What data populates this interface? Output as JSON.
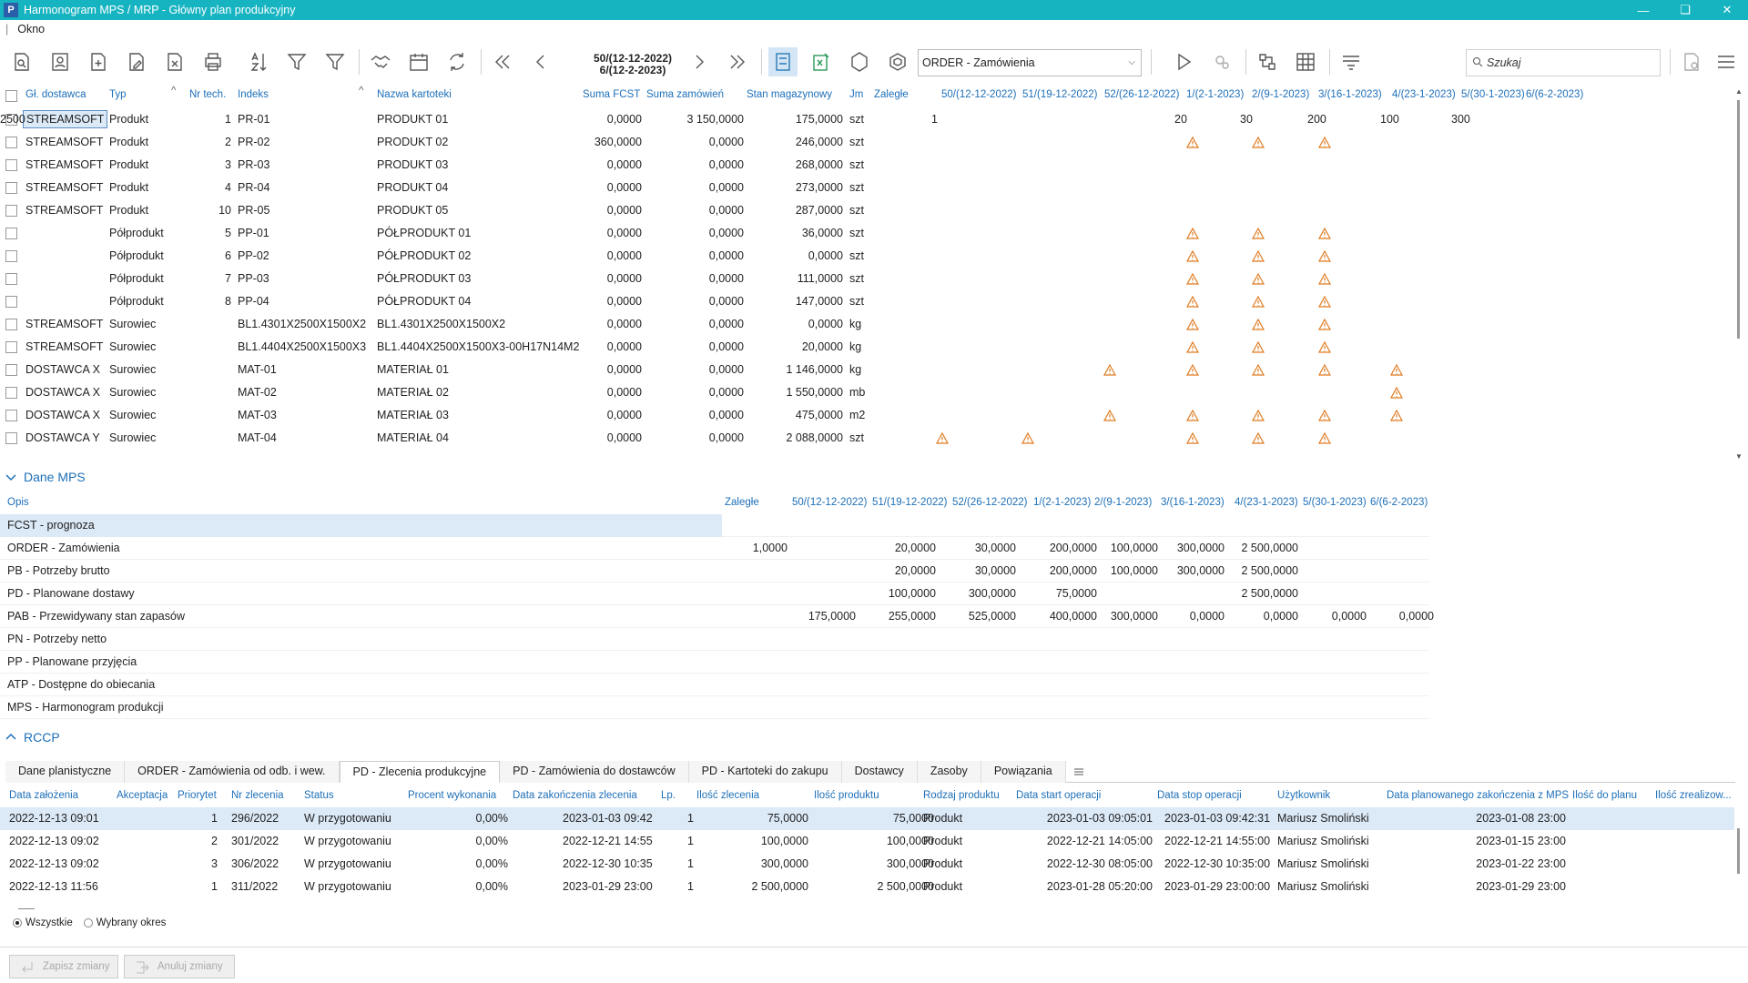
{
  "window": {
    "title": "Harmonogram MPS / MRP  - Główny plan produkcyjny",
    "app_icon": "P"
  },
  "menu": {
    "items": [
      "Okno"
    ]
  },
  "toolbar": {
    "period_line1": "50/(12-12-2022)",
    "period_line2": "6/(12-2-2023)",
    "order_select": "ORDER - Zamówienia",
    "search_placeholder": "Szukaj"
  },
  "grid": {
    "headers": {
      "dostawca": "Gł. dostawca",
      "typ": "Typ",
      "nrtech": "Nr tech.",
      "indeks": "Indeks",
      "nazwa": "Nazwa kartoteki",
      "fcst": "Suma FCST",
      "zam": "Suma zamówień",
      "stan": "Stan magazynowy",
      "jm": "Jm",
      "zalegle": "Zaległe",
      "periods": [
        "50/(12-12-2022)",
        "51/(19-12-2022)",
        "52/(26-12-2022)",
        "1/(2-1-2023)",
        "2/(9-1-2023)",
        "3/(16-1-2023)",
        "4/(23-1-2023)",
        "5/(30-1-2023)",
        "6/(6-2-2023)"
      ]
    },
    "rows": [
      {
        "dost": "STREAMSOFT",
        "typ": "Produkt",
        "nr": "1",
        "idx": "PR-01",
        "nazwa": "PRODUKT 01",
        "fcst": "0,0000",
        "zam": "3 150,0000",
        "stan": "175,0000",
        "jm": "szt",
        "vals": [
          "1",
          "",
          "20",
          "30",
          "200",
          "100",
          "300",
          "2500"
        ],
        "warn": []
      },
      {
        "dost": "STREAMSOFT",
        "typ": "Produkt",
        "nr": "2",
        "idx": "PR-02",
        "nazwa": "PRODUKT 02",
        "fcst": "360,0000",
        "zam": "0,0000",
        "stan": "246,0000",
        "jm": "szt",
        "vals": [],
        "warn": [
          4,
          5,
          6
        ]
      },
      {
        "dost": "STREAMSOFT",
        "typ": "Produkt",
        "nr": "3",
        "idx": "PR-03",
        "nazwa": "PRODUKT 03",
        "fcst": "0,0000",
        "zam": "0,0000",
        "stan": "268,0000",
        "jm": "szt",
        "vals": [],
        "warn": []
      },
      {
        "dost": "STREAMSOFT",
        "typ": "Produkt",
        "nr": "4",
        "idx": "PR-04",
        "nazwa": "PRODUKT 04",
        "fcst": "0,0000",
        "zam": "0,0000",
        "stan": "273,0000",
        "jm": "szt",
        "vals": [],
        "warn": []
      },
      {
        "dost": "STREAMSOFT",
        "typ": "Produkt",
        "nr": "10",
        "idx": "PR-05",
        "nazwa": "PRODUKT 05",
        "fcst": "0,0000",
        "zam": "0,0000",
        "stan": "287,0000",
        "jm": "szt",
        "vals": [],
        "warn": []
      },
      {
        "dost": "",
        "typ": "Półprodukt",
        "nr": "5",
        "idx": "PP-01",
        "nazwa": "PÓŁPRODUKT 01",
        "fcst": "0,0000",
        "zam": "0,0000",
        "stan": "36,0000",
        "jm": "szt",
        "vals": [],
        "warn": [
          4,
          5,
          6
        ]
      },
      {
        "dost": "",
        "typ": "Półprodukt",
        "nr": "6",
        "idx": "PP-02",
        "nazwa": "PÓŁPRODUKT 02",
        "fcst": "0,0000",
        "zam": "0,0000",
        "stan": "0,0000",
        "jm": "szt",
        "vals": [],
        "warn": [
          4,
          5,
          6
        ]
      },
      {
        "dost": "",
        "typ": "Półprodukt",
        "nr": "7",
        "idx": "PP-03",
        "nazwa": "PÓŁPRODUKT 03",
        "fcst": "0,0000",
        "zam": "0,0000",
        "stan": "111,0000",
        "jm": "szt",
        "vals": [],
        "warn": [
          4,
          5,
          6
        ]
      },
      {
        "dost": "",
        "typ": "Półprodukt",
        "nr": "8",
        "idx": "PP-04",
        "nazwa": "PÓŁPRODUKT 04",
        "fcst": "0,0000",
        "zam": "0,0000",
        "stan": "147,0000",
        "jm": "szt",
        "vals": [],
        "warn": [
          4,
          5,
          6
        ]
      },
      {
        "dost": "STREAMSOFT",
        "typ": "Surowiec",
        "nr": "",
        "idx": "BL1.4301X2500X1500X2",
        "nazwa": "BL1.4301X2500X1500X2",
        "fcst": "0,0000",
        "zam": "0,0000",
        "stan": "0,0000",
        "jm": "kg",
        "vals": [],
        "warn": [
          4,
          5,
          6
        ]
      },
      {
        "dost": "STREAMSOFT",
        "typ": "Surowiec",
        "nr": "",
        "idx": "BL1.4404X2500X1500X3",
        "nazwa": "BL1.4404X2500X1500X3-00H17N14M2",
        "fcst": "0,0000",
        "zam": "0,0000",
        "stan": "20,0000",
        "jm": "kg",
        "vals": [],
        "warn": [
          4,
          5,
          6
        ]
      },
      {
        "dost": "DOSTAWCA X",
        "typ": "Surowiec",
        "nr": "",
        "idx": "MAT-01",
        "nazwa": "MATERIAŁ 01",
        "fcst": "0,0000",
        "zam": "0,0000",
        "stan": "1 146,0000",
        "jm": "kg",
        "vals": [],
        "warn": [
          3,
          4,
          5,
          6,
          7
        ]
      },
      {
        "dost": "DOSTAWCA X",
        "typ": "Surowiec",
        "nr": "",
        "idx": "MAT-02",
        "nazwa": "MATERIAŁ 02",
        "fcst": "0,0000",
        "zam": "0,0000",
        "stan": "1 550,0000",
        "jm": "mb",
        "vals": [],
        "warn": [
          7
        ]
      },
      {
        "dost": "DOSTAWCA X",
        "typ": "Surowiec",
        "nr": "",
        "idx": "MAT-03",
        "nazwa": "MATERIAŁ 03",
        "fcst": "0,0000",
        "zam": "0,0000",
        "stan": "475,0000",
        "jm": "m2",
        "vals": [],
        "warn": [
          3,
          4,
          5,
          6,
          7
        ]
      },
      {
        "dost": "DOSTAWCA Y",
        "typ": "Surowiec",
        "nr": "",
        "idx": "MAT-04",
        "nazwa": "MATERIAŁ 04",
        "fcst": "0,0000",
        "zam": "0,0000",
        "stan": "2 088,0000",
        "jm": "szt",
        "vals": [],
        "warn": [
          1,
          2,
          4,
          5,
          6
        ]
      }
    ]
  },
  "mps": {
    "section_title": "Dane MPS",
    "headers": {
      "opis": "Opis",
      "zalegle": "Zaległe",
      "periods": [
        "50/(12-12-2022)",
        "51/(19-12-2022)",
        "52/(26-12-2022)",
        "1/(2-1-2023)",
        "2/(9-1-2023)",
        "3/(16-1-2023)",
        "4/(23-1-2023)",
        "5/(30-1-2023)",
        "6/(6-2-2023)"
      ]
    },
    "rows": [
      {
        "opis": "FCST - prognoza",
        "vals": [
          "",
          "",
          "",
          "",
          "",
          "",
          "",
          "",
          "",
          ""
        ]
      },
      {
        "opis": "ORDER - Zamówienia",
        "vals": [
          "1,0000",
          "",
          "20,0000",
          "30,0000",
          "200,0000",
          "100,0000",
          "300,0000",
          "2 500,0000",
          "",
          ""
        ]
      },
      {
        "opis": "PB - Potrzeby brutto",
        "vals": [
          "",
          "",
          "20,0000",
          "30,0000",
          "200,0000",
          "100,0000",
          "300,0000",
          "2 500,0000",
          "",
          ""
        ]
      },
      {
        "opis": "PD - Planowane dostawy",
        "vals": [
          "",
          "",
          "100,0000",
          "300,0000",
          "75,0000",
          "",
          "",
          "2 500,0000",
          "",
          ""
        ]
      },
      {
        "opis": "PAB - Przewidywany stan zapasów",
        "vals": [
          "",
          "175,0000",
          "255,0000",
          "525,0000",
          "400,0000",
          "300,0000",
          "0,0000",
          "0,0000",
          "0,0000",
          "0,0000"
        ]
      },
      {
        "opis": "PN - Potrzeby netto",
        "vals": []
      },
      {
        "opis": "PP - Planowane przyjęcia",
        "vals": []
      },
      {
        "opis": "ATP - Dostępne do obiecania",
        "vals": []
      },
      {
        "opis": "MPS - Harmonogram produkcji",
        "vals": []
      }
    ]
  },
  "rccp": {
    "section_title": "RCCP"
  },
  "tabs": [
    "Dane planistyczne",
    "ORDER - Zamówienia od odb. i wew.",
    "PD - Zlecenia produkcyjne",
    "PD - Zamówienia do dostawców",
    "PD - Kartoteki do zakupu",
    "Dostawcy",
    "Zasoby",
    "Powiązania"
  ],
  "active_tab": 2,
  "orders": {
    "headers": [
      "Data założenia",
      "Akceptacja",
      "Priorytet",
      "Nr zlecenia",
      "Status",
      "Procent wykonania",
      "Data zakończenia zlecenia",
      "Lp.",
      "Ilość zlecenia",
      "Ilość produktu",
      "Rodzaj produktu",
      "Data start operacji",
      "Data stop operacji",
      "Użytkownik",
      "Data planowanego zakończenia z MPS",
      "Ilość do planu",
      "Ilość zrealizow..."
    ],
    "rows": [
      [
        "2022-12-13 09:01",
        "",
        "1",
        "296/2022",
        "W przygotowaniu",
        "0,00%",
        "2023-01-03 09:42",
        "1",
        "75,0000",
        "75,0000",
        "Produkt",
        "2023-01-03 09:05:01",
        "2023-01-03 09:42:31",
        "Mariusz Smoliński",
        "2023-01-08 23:00"
      ],
      [
        "2022-12-13 09:02",
        "",
        "2",
        "301/2022",
        "W przygotowaniu",
        "0,00%",
        "2022-12-21 14:55",
        "1",
        "100,0000",
        "100,0000",
        "Produkt",
        "2022-12-21 14:05:00",
        "2022-12-21 14:55:00",
        "Mariusz Smoliński",
        "2023-01-15 23:00"
      ],
      [
        "2022-12-13 09:02",
        "",
        "3",
        "306/2022",
        "W przygotowaniu",
        "0,00%",
        "2022-12-30 10:35",
        "1",
        "300,0000",
        "300,0000",
        "Produkt",
        "2022-12-30 08:05:00",
        "2022-12-30 10:35:00",
        "Mariusz Smoliński",
        "2023-01-22 23:00"
      ],
      [
        "2022-12-13 11:56",
        "",
        "1",
        "311/2022",
        "W przygotowaniu",
        "0,00%",
        "2023-01-29 23:00",
        "1",
        "2 500,0000",
        "2 500,0000",
        "Produkt",
        "2023-01-28 05:20:00",
        "2023-01-29 23:00:00",
        "Mariusz Smoliński",
        "2023-01-29 23:00"
      ]
    ]
  },
  "filter": {
    "all": "Wszystkie",
    "range": "Wybrany okres"
  },
  "footer": {
    "save": "Zapisz zmiany",
    "cancel": "Anuluj zmiany"
  },
  "colors": {
    "titlebar": "#16b4c1",
    "header_text": "#1d6fb8",
    "warn": "#e07a1f",
    "selection": "#dce9f7"
  }
}
